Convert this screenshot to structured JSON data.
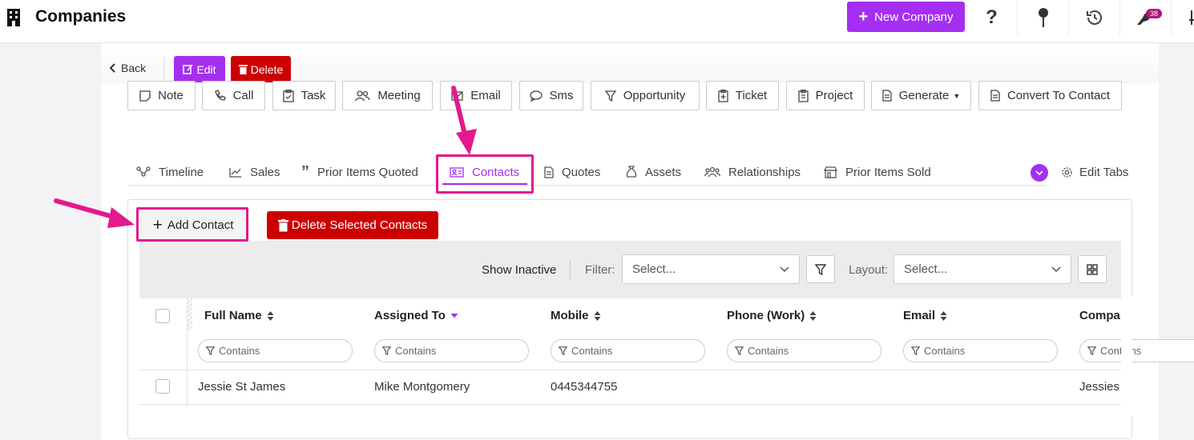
{
  "topbar": {
    "title": "Companies",
    "new_company_label": "New Company",
    "notifications_count": "38",
    "icons": [
      "building-icon",
      "help-icon",
      "pin-icon",
      "history-icon",
      "bird-icon",
      "settings-sliders-icon"
    ]
  },
  "toolbar": {
    "back_label": "Back",
    "edit_label": "Edit",
    "delete_label": "Delete"
  },
  "actions": [
    "Note",
    "Call",
    "Task",
    "Meeting",
    "Email",
    "Sms",
    "Opportunity",
    "Ticket",
    "Project",
    "Generate",
    "Convert To Contact"
  ],
  "tabs": [
    "Timeline",
    "Sales",
    "Prior Items Quoted",
    "Contacts",
    "Quotes",
    "Assets",
    "Relationships",
    "Prior Items Sold"
  ],
  "active_tab": "Contacts",
  "edit_tabs_label": "Edit Tabs",
  "contacts": {
    "add_label": "Add Contact",
    "delete_selected_label": "Delete Selected Contacts",
    "show_inactive_label": "Show Inactive",
    "filter_label": "Filter:",
    "filter_placeholder": "Select...",
    "layout_label": "Layout:",
    "layout_placeholder": "Select...",
    "columns": [
      "Full Name",
      "Assigned To",
      "Mobile",
      "Phone (Work)",
      "Email",
      "Compar"
    ],
    "column_filter_placeholder": "Contains",
    "rows": [
      {
        "full_name": "Jessie St James",
        "assigned_to": "Mike Montgomery",
        "mobile": "0445344755",
        "phone_work": "",
        "email": "",
        "company": "Jessies ("
      }
    ]
  },
  "colors": {
    "accent": "#a52ff0",
    "danger": "#cc0000",
    "annotation": "#e3198c"
  }
}
